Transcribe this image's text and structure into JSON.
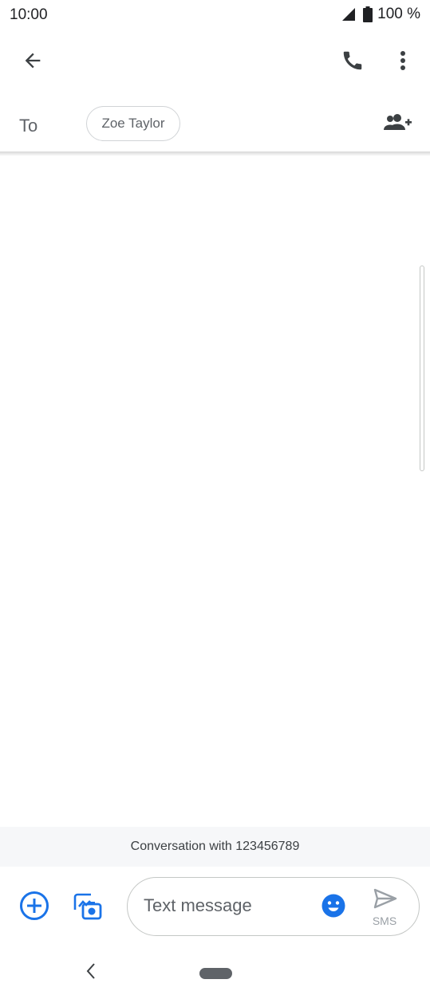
{
  "status_bar": {
    "time": "10:00",
    "battery_percent": "100 %",
    "icons": [
      "signal-icon",
      "battery-icon"
    ]
  },
  "app_bar": {
    "icons": [
      "back-arrow-icon",
      "phone-icon",
      "more-vert-icon"
    ]
  },
  "recipients": {
    "to_label": "To",
    "chips": [
      "Zoe Taylor"
    ],
    "add_icon": "add-person-icon"
  },
  "conversation": {
    "banner": "Conversation with 123456789"
  },
  "compose": {
    "placeholder": "Text message",
    "send_label": "SMS",
    "icons": [
      "add-circle-icon",
      "gallery-camera-icon",
      "emoji-icon",
      "send-icon"
    ]
  },
  "nav_bar": {
    "icons": [
      "nav-back-icon",
      "home-pill"
    ]
  },
  "colors": {
    "accent": "#1a73e8",
    "icon_dark": "#3c4043",
    "text_secondary": "#5f6368",
    "banner_bg": "#f6f7f9",
    "send_disabled": "#9aa0a6"
  }
}
